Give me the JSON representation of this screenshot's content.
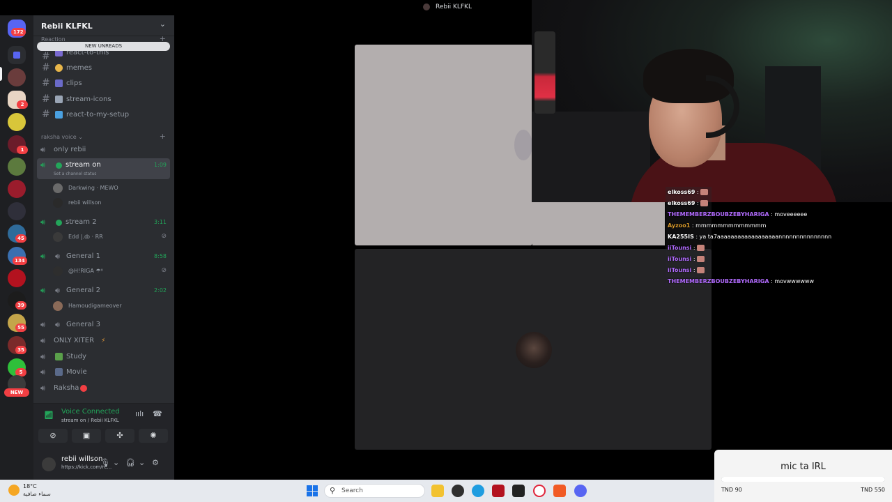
{
  "window": {
    "title": "Rebii KLFKL"
  },
  "rail": {
    "home_badge": "172",
    "badges": [
      "2",
      "1",
      "45",
      "134",
      "39",
      "55",
      "35",
      "5"
    ],
    "new_label": "NEW"
  },
  "server": {
    "name": "Rebii KLFKL",
    "faint_category": "Reaction",
    "new_unreads": "NEW UNREADS",
    "text_channels": [
      {
        "name": "react-to-this"
      },
      {
        "name": "memes"
      },
      {
        "name": "clips"
      },
      {
        "name": "stream-icons"
      },
      {
        "name": "react-to-my-setup"
      }
    ],
    "voice_category": "raksha voice",
    "voice_channels": {
      "only_rebii": "only rebii",
      "stream_on": {
        "name": "stream on",
        "duration": "1:09",
        "status": "Set a channel status"
      },
      "stream_on_members": [
        {
          "name": "Darkwing",
          "extra": "MEWO"
        },
        {
          "name": "rebii willson"
        }
      ],
      "stream_2": {
        "name": "stream 2",
        "duration": "3:11"
      },
      "stream_2_members": [
        {
          "name": "Edd |.ȸ",
          "extra": "RR"
        }
      ],
      "general_1": {
        "name": "General 1",
        "duration": "8:58"
      },
      "general_1_members": [
        {
          "name": "@H!RIGA ☂ᵗⁱ"
        }
      ],
      "general_2": {
        "name": "General 2",
        "duration": "2:02"
      },
      "general_2_members": [
        {
          "name": "Hamoudigameover"
        }
      ],
      "general_3": "General 3",
      "only_xiter": "ONLY XITER",
      "study": "Study",
      "movie": "Movie",
      "raksha": "Raksha"
    }
  },
  "voice": {
    "status": "Voice Connected",
    "where": "stream on / Rebii KLFKL"
  },
  "user": {
    "name": "rebii willson",
    "status": "https://kick.com/re..."
  },
  "chat": [
    {
      "user": "elkoss69",
      "color": "#ffffff",
      "msg": "",
      "emote": true
    },
    {
      "user": "elkoss69",
      "color": "#ffffff",
      "msg": "",
      "emote": true
    },
    {
      "user": "THEMEMBERZBOUBZEBYHARIGA",
      "color": "#b26bff",
      "msg": "moveeeeee",
      "emote": false
    },
    {
      "user": "Ayzoo1",
      "color": "#d99a2b",
      "msg": "mmmmmmmmmmmmm",
      "emote": false
    },
    {
      "user": "KA255IS",
      "color": "#ffffff",
      "msg": "ya ta7aaaaaaaaaaaaaaaaaannnnnnnnnnnnnnn",
      "emote": false
    },
    {
      "user": "iiTounsi",
      "color": "#b26bff",
      "msg": "",
      "emote": true
    },
    {
      "user": "iiTounsi",
      "color": "#b26bff",
      "msg": "",
      "emote": true
    },
    {
      "user": "iiTounsi",
      "color": "#b26bff",
      "msg": "",
      "emote": true
    },
    {
      "user": "THEMEMBERZBOUBZEBYHARIGA",
      "color": "#b26bff",
      "msg": "movwwwwww",
      "emote": false
    }
  ],
  "goal": {
    "title": "mic ta IRL",
    "min_label": "TND 90",
    "max_label": "TND 550",
    "progress_fraction": 1.0
  },
  "taskbar": {
    "temperature": "18°C",
    "weather": "سماء صافية",
    "search_placeholder": "Search"
  },
  "colors": {
    "discord_green": "#23a55a",
    "discord_red": "#f23f43",
    "sidebar_bg": "#2b2d31",
    "rail_bg": "#1e1f22"
  }
}
